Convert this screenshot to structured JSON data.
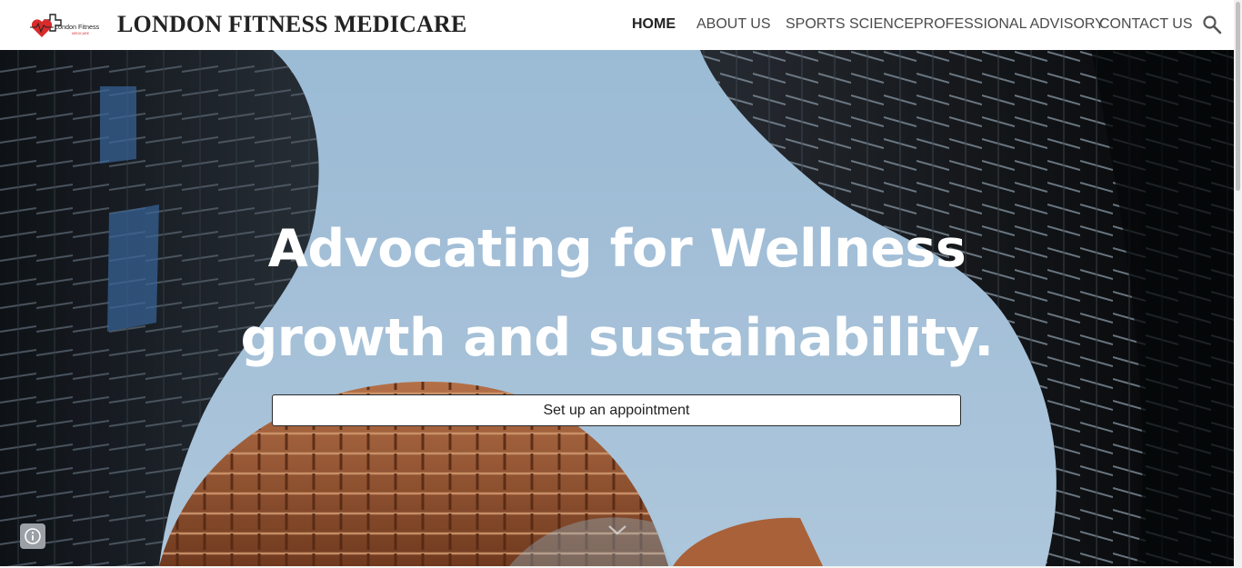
{
  "header": {
    "logo": {
      "text_main": "London Fitness",
      "text_sub": "MEDICARE"
    },
    "site_title": "LONDON FITNESS MEDICARE",
    "nav": [
      {
        "label": "HOME",
        "active": true
      },
      {
        "label": "ABOUT US",
        "active": false
      },
      {
        "label": "SPORTS SCIENCE",
        "active": false
      },
      {
        "label": "PROFESSIONAL ADVISORY",
        "active": false
      },
      {
        "label": "CONTACT US",
        "active": false
      }
    ],
    "search_icon": "search-icon"
  },
  "hero": {
    "title_line1": "Advocating for Wellness",
    "title_line2": "growth and sustainability.",
    "cta_label": "Set up an appointment",
    "scroll_icon": "chevron-down-icon",
    "info_icon": "info-icon"
  },
  "colors": {
    "sky": "#b4d2ec",
    "building_dark": "#1e2329",
    "building_copper": "#b0643c",
    "accent_red": "#d92b2b"
  }
}
